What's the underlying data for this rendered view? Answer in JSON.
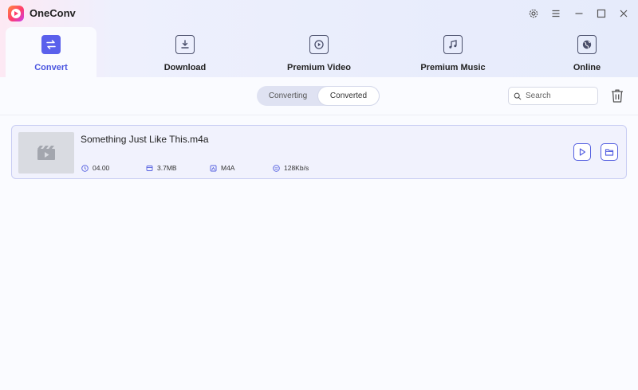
{
  "app": {
    "name": "OneConv"
  },
  "window_controls": [
    {
      "name": "settings-icon"
    },
    {
      "name": "menu-icon"
    },
    {
      "name": "minimize-icon"
    },
    {
      "name": "maximize-icon"
    },
    {
      "name": "close-icon"
    }
  ],
  "nav": {
    "tabs": [
      {
        "label": "Convert",
        "icon": "convert-icon",
        "active": true
      },
      {
        "label": "Download",
        "icon": "download-icon",
        "active": false
      },
      {
        "label": "Premium Video",
        "icon": "premium-video-icon",
        "active": false
      },
      {
        "label": "Premium Music",
        "icon": "premium-music-icon",
        "active": false
      },
      {
        "label": "Online",
        "icon": "online-icon",
        "active": false
      }
    ]
  },
  "toolbar": {
    "segments": [
      {
        "label": "Converting",
        "selected": false
      },
      {
        "label": "Converted",
        "selected": true
      }
    ],
    "search": {
      "placeholder": "Search",
      "value": ""
    }
  },
  "files": [
    {
      "name": "Something Just Like This.m4a",
      "duration": "04.00",
      "size": "3.7MB",
      "format": "M4A",
      "bitrate": "128Kb/s"
    }
  ],
  "colors": {
    "accent": "#5a60ec",
    "active_label": "#4a55e0",
    "card_border": "#c9cdf3",
    "card_bg": "#f1f2fd"
  }
}
